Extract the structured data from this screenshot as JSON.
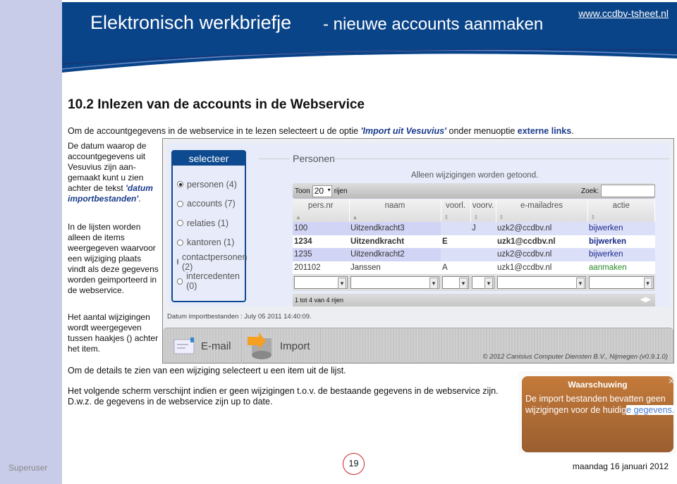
{
  "header": {
    "title": "Elektronisch werkbriefje",
    "subtitle": "- nieuwe accounts aanmaken",
    "url": "www.ccdbv-tsheet.nl"
  },
  "heading": "10.2 Inlezen van de accounts in de Webservice",
  "intro": {
    "before": "Om de accountgegevens in de webservice in te lezen selecteert u de optie ",
    "option": "'Import uit Vesuvius'",
    "middle": " onder menuoptie ",
    "menu": "externe links",
    "end": "."
  },
  "side": {
    "p1": "De datum waarop de accountgegevens uit Vesuvius zijn aan-gemaakt kunt u zien achter de tekst ",
    "p1_em": "'datum importbestanden'",
    "p1_end": ".",
    "p2": "In de lijsten worden alleen de items weergegeven waarvoor een wijziging plaats vindt als deze gegevens worden geimporteerd in de webservice.",
    "p3": "Het aantal wijzigingen wordt weergegeven tussen haakjes () achter het item."
  },
  "app": {
    "select_title": "selecteer",
    "options": [
      {
        "label": "personen (4)",
        "checked": true
      },
      {
        "label": "accounts (7)"
      },
      {
        "label": "relaties (1)"
      },
      {
        "label": "kantoren (1)"
      },
      {
        "label": "contactpersonen (2)"
      },
      {
        "label": "intercedenten (0)"
      }
    ],
    "section": "Personen",
    "notice": "Alleen wijzigingen worden getoond.",
    "show": "Toon",
    "show_value": "20",
    "rows_label": "rijen",
    "search": "Zoek:",
    "columns": [
      "pers.nr",
      "naam",
      "voorl.",
      "voorv.",
      "e-mailadres",
      "actie"
    ],
    "rows": [
      [
        "100",
        "Uitzendkracht3",
        "",
        "J",
        "uzk2@ccdbv.nl",
        "bijwerken"
      ],
      [
        "1234",
        "Uitzendkracht",
        "E",
        "",
        "uzk1@ccdbv.nl",
        "bijwerken"
      ],
      [
        "1235",
        "Uitzendkracht2",
        "",
        "",
        "uzk2@ccdbv.nl",
        "bijwerken"
      ],
      [
        "201102",
        "Janssen",
        "A",
        "",
        "uzk1@ccdbv.nl",
        "aanmaken"
      ]
    ],
    "paging": "1 tot 4 van 4 rijen",
    "datum": "Datum importbestanden : July 05 2011 14:40:09.",
    "email": "E-mail",
    "import": "Import",
    "copyright": "© 2012 Canisius Computer Diensten B.V., Nijmegen (v0.9.1.0)"
  },
  "bottom": {
    "l1": "Om de details te zien van een wijziging selecteert u een item uit de lijst.",
    "l2": "Het volgende scherm verschijnt indien er geen wijzigingen t.o.v. de bestaande gegevens in de webservice zijn.",
    "l3": "D.w.z. de gegevens in de webservice zijn up to date."
  },
  "warning": {
    "title": "Waarschuwing",
    "msg": "De import bestanden bevatten geen wijzigingen voor de huidig",
    "msg_sel": "e gegevens."
  },
  "footer": {
    "user": "Superuser",
    "page": "19",
    "date": "maandag 16 januari 2012"
  }
}
